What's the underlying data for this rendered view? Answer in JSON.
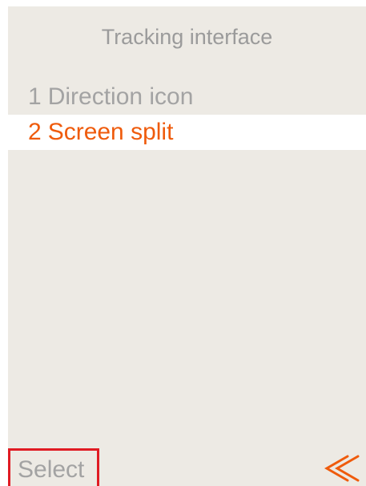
{
  "header": {
    "title": "Tracking interface"
  },
  "menu": {
    "items": [
      {
        "number": "1",
        "label": "Direction icon",
        "selected": false
      },
      {
        "number": "2",
        "label": "Screen split",
        "selected": true
      }
    ]
  },
  "footer": {
    "select_label": "Select",
    "back_icon": "double-left-chevron-icon"
  },
  "colors": {
    "screen_background": "#edeae4",
    "selected_row_background": "#ffffff",
    "accent": "#ef5b0c",
    "muted_text": "#a3a3a3",
    "softkey_highlight": "#e01b23"
  }
}
